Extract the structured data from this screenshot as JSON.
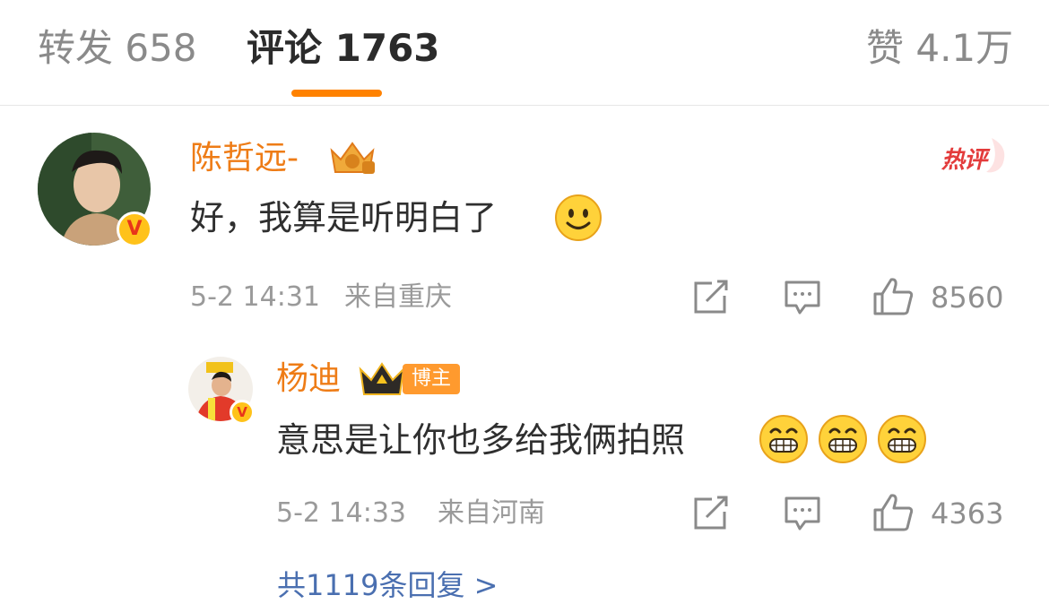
{
  "tabs": {
    "repost": "转发 658",
    "comments": "评论 1763",
    "likes": "赞 4.1万"
  },
  "comment": {
    "user": "陈哲远-",
    "hot_badge": "热评",
    "text": "好，我算是听明白了",
    "time": "5-2 14:31",
    "location": "来自重庆",
    "like_count": "8560"
  },
  "reply": {
    "user": "杨迪",
    "badge": "博主",
    "text": "意思是让你也多给我俩拍照",
    "time": "5-2 14:33",
    "location": "来自河南",
    "like_count": "4363"
  },
  "more_replies": "共1119条回复 >",
  "colors": {
    "accent": "#ff8200",
    "username": "#ee7c16",
    "hot": "#e33b3b"
  }
}
